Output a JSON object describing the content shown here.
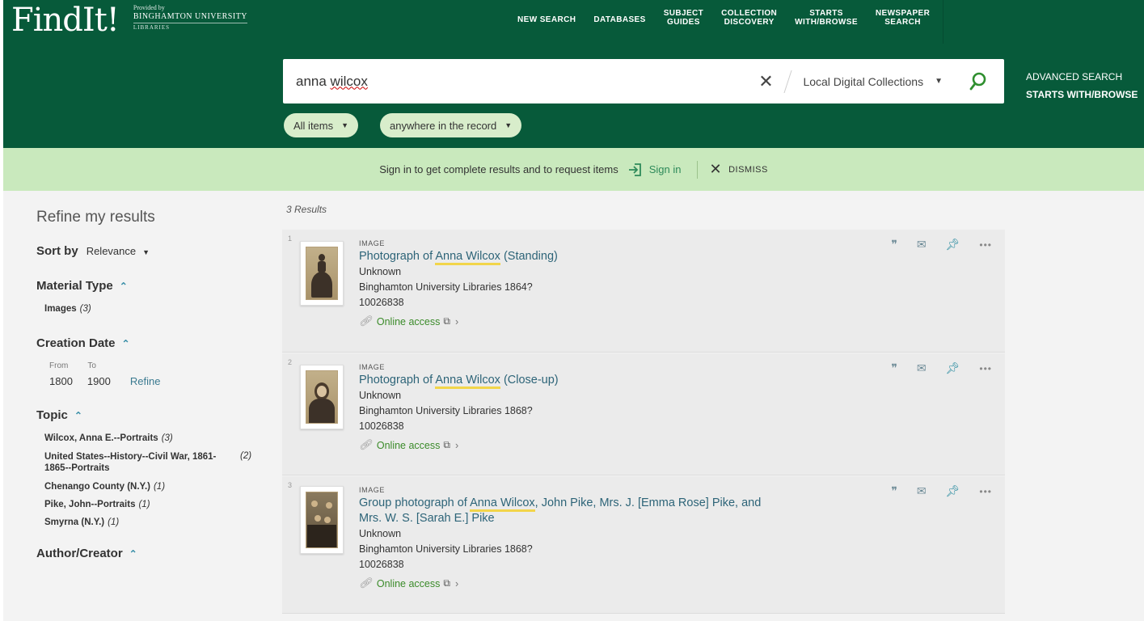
{
  "header": {
    "logo": "FindIt!",
    "provider_small": "Provided by",
    "provider_name": "BINGHAMTON UNIVERSITY",
    "provider_sub": "LIBRARIES",
    "nav": [
      "NEW SEARCH",
      "DATABASES",
      "SUBJECT\nGUIDES",
      "COLLECTION\nDISCOVERY",
      "STARTS\nWITH/BROWSE",
      "NEWSPAPER\nSEARCH"
    ]
  },
  "search": {
    "query_word1": "anna ",
    "query_word2": "wilcox",
    "scope": "Local Digital Collections",
    "advanced": "ADVANCED SEARCH",
    "browse": "STARTS WITH/BROWSE",
    "filter1": "All items",
    "filter2": "anywhere in the record"
  },
  "banner": {
    "message": "Sign in to get complete results and to request items",
    "signin": "Sign in",
    "dismiss": "DISMISS"
  },
  "facets": {
    "title": "Refine my results",
    "sort_label": "Sort by",
    "sort_value": "Relevance",
    "material_type": "Material Type",
    "material_items": [
      {
        "label": "Images",
        "count": "(3)"
      }
    ],
    "creation_date": "Creation Date",
    "from_label": "From",
    "to_label": "To",
    "from_value": "1800",
    "to_value": "1900",
    "refine": "Refine",
    "topic": "Topic",
    "topic_items": [
      {
        "label": "Wilcox, Anna E.--Portraits",
        "count": "(3)"
      },
      {
        "label": "United States--History--Civil War, 1861-\n1865--Portraits",
        "count": "(2)"
      },
      {
        "label": "Chenango County (N.Y.)",
        "count": "(1)"
      },
      {
        "label": "Pike, John--Portraits",
        "count": "(1)"
      },
      {
        "label": "Smyrna (N.Y.)",
        "count": "(1)"
      }
    ],
    "author": "Author/Creator"
  },
  "results": {
    "count": "3 Results",
    "online": "Online access",
    "items": [
      {
        "num": "1",
        "type": "IMAGE",
        "pre": "Photograph of ",
        "hl": "Anna Wilcox",
        "post": " (Standing)",
        "post2": "",
        "creator": "Unknown",
        "pub": "Binghamton University Libraries 1864?",
        "id": "10026838"
      },
      {
        "num": "2",
        "type": "IMAGE",
        "pre": "Photograph of ",
        "hl": "Anna Wilcox",
        "post": " (Close-up)",
        "post2": "",
        "creator": "Unknown",
        "pub": "Binghamton University Libraries 1868?",
        "id": "10026838"
      },
      {
        "num": "3",
        "type": "IMAGE",
        "pre": "Group photograph of ",
        "hl": "Anna Wilcox",
        "post": ", John Pike, Mrs. J. [Emma Rose] Pike, and",
        "post2": "Mrs. W. S. [Sarah E.] Pike",
        "creator": "Unknown",
        "pub": "Binghamton University Libraries 1868?",
        "id": "10026838"
      }
    ]
  },
  "colors": {
    "header_green": "#075a3a",
    "banner_green": "#c9e9bd",
    "link_teal": "#2d6478",
    "highlight": "#f2d54a"
  }
}
